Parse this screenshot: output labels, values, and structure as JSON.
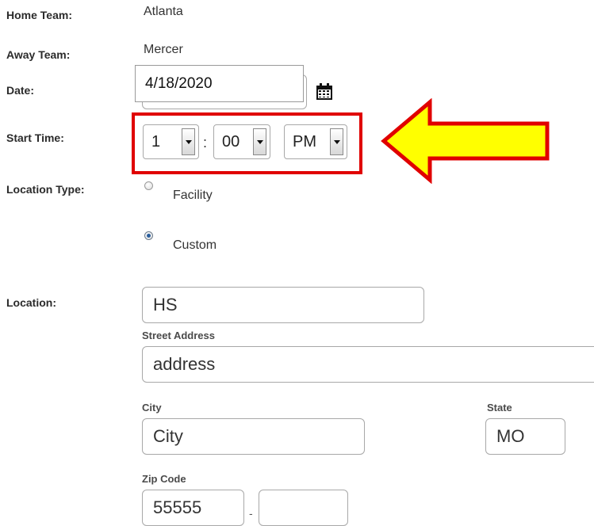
{
  "form": {
    "home_team": {
      "label": "Home Team:",
      "value": "Atlanta"
    },
    "away_team": {
      "label": "Away Team:",
      "value": "Mercer"
    },
    "date": {
      "label": "Date:",
      "value": "4/18/2020"
    },
    "start_time": {
      "label": "Start Time:",
      "hour": "1",
      "separator": ":",
      "minute": "00",
      "ampm": "PM"
    },
    "location_type": {
      "label": "Location Type:",
      "options": [
        {
          "label": "Facility",
          "selected": false
        },
        {
          "label": "Custom",
          "selected": true
        }
      ]
    },
    "location": {
      "label": "Location:",
      "name_value": "HS",
      "street_label": "Street Address",
      "street_value": "address",
      "city_label": "City",
      "city_value": "City",
      "state_label": "State",
      "state_value": "MO",
      "zip_label": "Zip Code",
      "zip_value": "55555",
      "zip_separator": "-",
      "zip_ext_value": ""
    }
  },
  "annotation": {
    "highlight_color": "#e00000",
    "arrow_fill": "#ffff00",
    "arrow_stroke": "#e00000"
  },
  "icons": {
    "calendar": "calendar-icon"
  }
}
